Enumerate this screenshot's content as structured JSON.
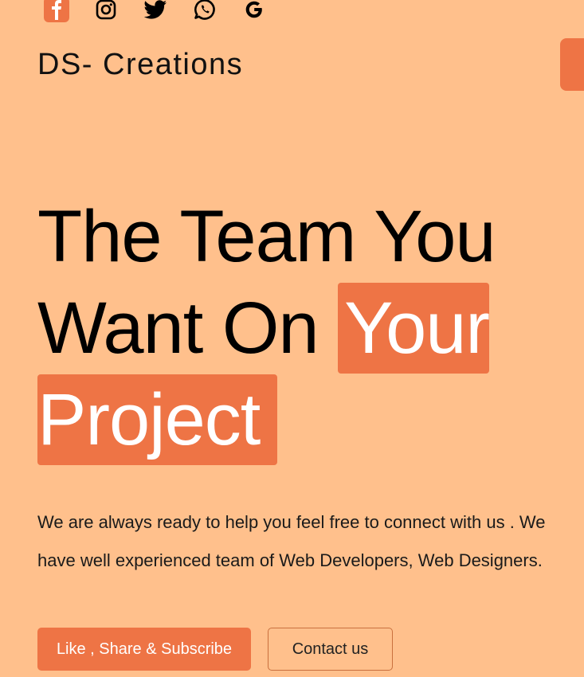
{
  "social": [
    {
      "name": "facebook-icon"
    },
    {
      "name": "instagram-icon"
    },
    {
      "name": "twitter-icon"
    },
    {
      "name": "whatsapp-icon"
    },
    {
      "name": "google-icon"
    }
  ],
  "brand": {
    "title": "DS- Creations"
  },
  "hero": {
    "line1": "The Team You",
    "line2_plain": "Want On ",
    "line2_highlight": "Your",
    "line3_highlight": "Project",
    "description": "We are always ready to help you feel free to connect with us . We have well experienced team of Web Developers, Web Designers."
  },
  "buttons": {
    "primary": "Like , Share & Subscribe",
    "secondary": "Contact us"
  },
  "colors": {
    "background": "#FFC08C",
    "accent": "#EE7445",
    "text": "#111111"
  }
}
